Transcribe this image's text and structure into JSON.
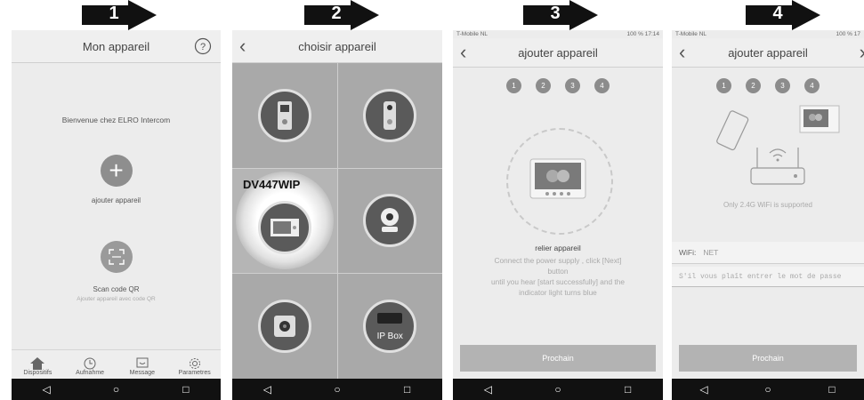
{
  "steps_markers": [
    "1",
    "2",
    "3",
    "4"
  ],
  "panel1": {
    "title": "Mon appareil",
    "help_icon": "question-icon",
    "welcome": "Bienvenue chez ELRO Intercom",
    "add_label": "ajouter appareil",
    "scan_label": "Scan code QR",
    "scan_sub": "Ajouter appareil avec code QR",
    "tabs": [
      {
        "label": "Dispositifs",
        "icon": "home-icon"
      },
      {
        "label": "Aufnahme",
        "icon": "clock-icon"
      },
      {
        "label": "Message",
        "icon": "message-icon"
      },
      {
        "label": "Parametres",
        "icon": "gear-icon"
      }
    ]
  },
  "panel2": {
    "title": "choisir appareil",
    "selected_label": "DV447WIP",
    "ipbox_label": "IP Box"
  },
  "panel3": {
    "status_left": "T-Mobile NL",
    "status_right": "100 % 17:14",
    "title": "ajouter appareil",
    "step_numbers": [
      "1",
      "2",
      "3",
      "4"
    ],
    "heading": "relier appareil",
    "line1": "Connect the power supply , click [Next]",
    "line2": "button",
    "line3": "until you hear [start successfully] and the",
    "line4": "indicator light turns blue",
    "button": "Prochain"
  },
  "panel4": {
    "status_left": "T-Mobile NL",
    "status_right": "100 % 17",
    "title": "ajouter appareil",
    "step_numbers": [
      "1",
      "2",
      "3",
      "4"
    ],
    "note": "Only 2.4G WiFi is supported",
    "wifi_label": "WiFi:",
    "wifi_value": "NET",
    "password_placeholder": "S'il vous plaît entrer le mot de passe",
    "button": "Prochain"
  },
  "android_nav": [
    "◁",
    "○",
    "□"
  ]
}
